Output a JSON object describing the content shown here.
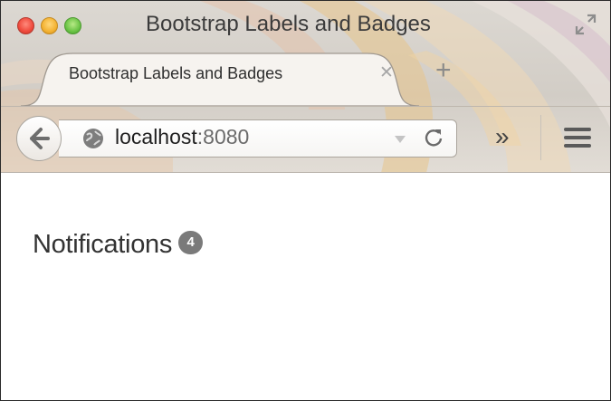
{
  "window": {
    "title": "Bootstrap Labels and Badges"
  },
  "tab": {
    "label": "Bootstrap Labels and Badges",
    "close_glyph": "✕"
  },
  "new_tab": {
    "glyph": "+"
  },
  "url": {
    "host": "localhost",
    "port": ":8080"
  },
  "toolbar": {
    "overflow_glyph": "»"
  },
  "page": {
    "heading": "Notifications",
    "badge": "4"
  },
  "colors": {
    "badge_bg": "#777777",
    "heading_text": "#333333",
    "close_button": "#ef4a3c",
    "minimize_button": "#f3b232",
    "zoom_button": "#6ac345"
  },
  "icons": [
    "back-arrow-icon",
    "globe-icon",
    "dropmarker-icon",
    "reload-icon",
    "overflow-icon",
    "hamburger-menu-icon",
    "fullscreen-icon"
  ]
}
